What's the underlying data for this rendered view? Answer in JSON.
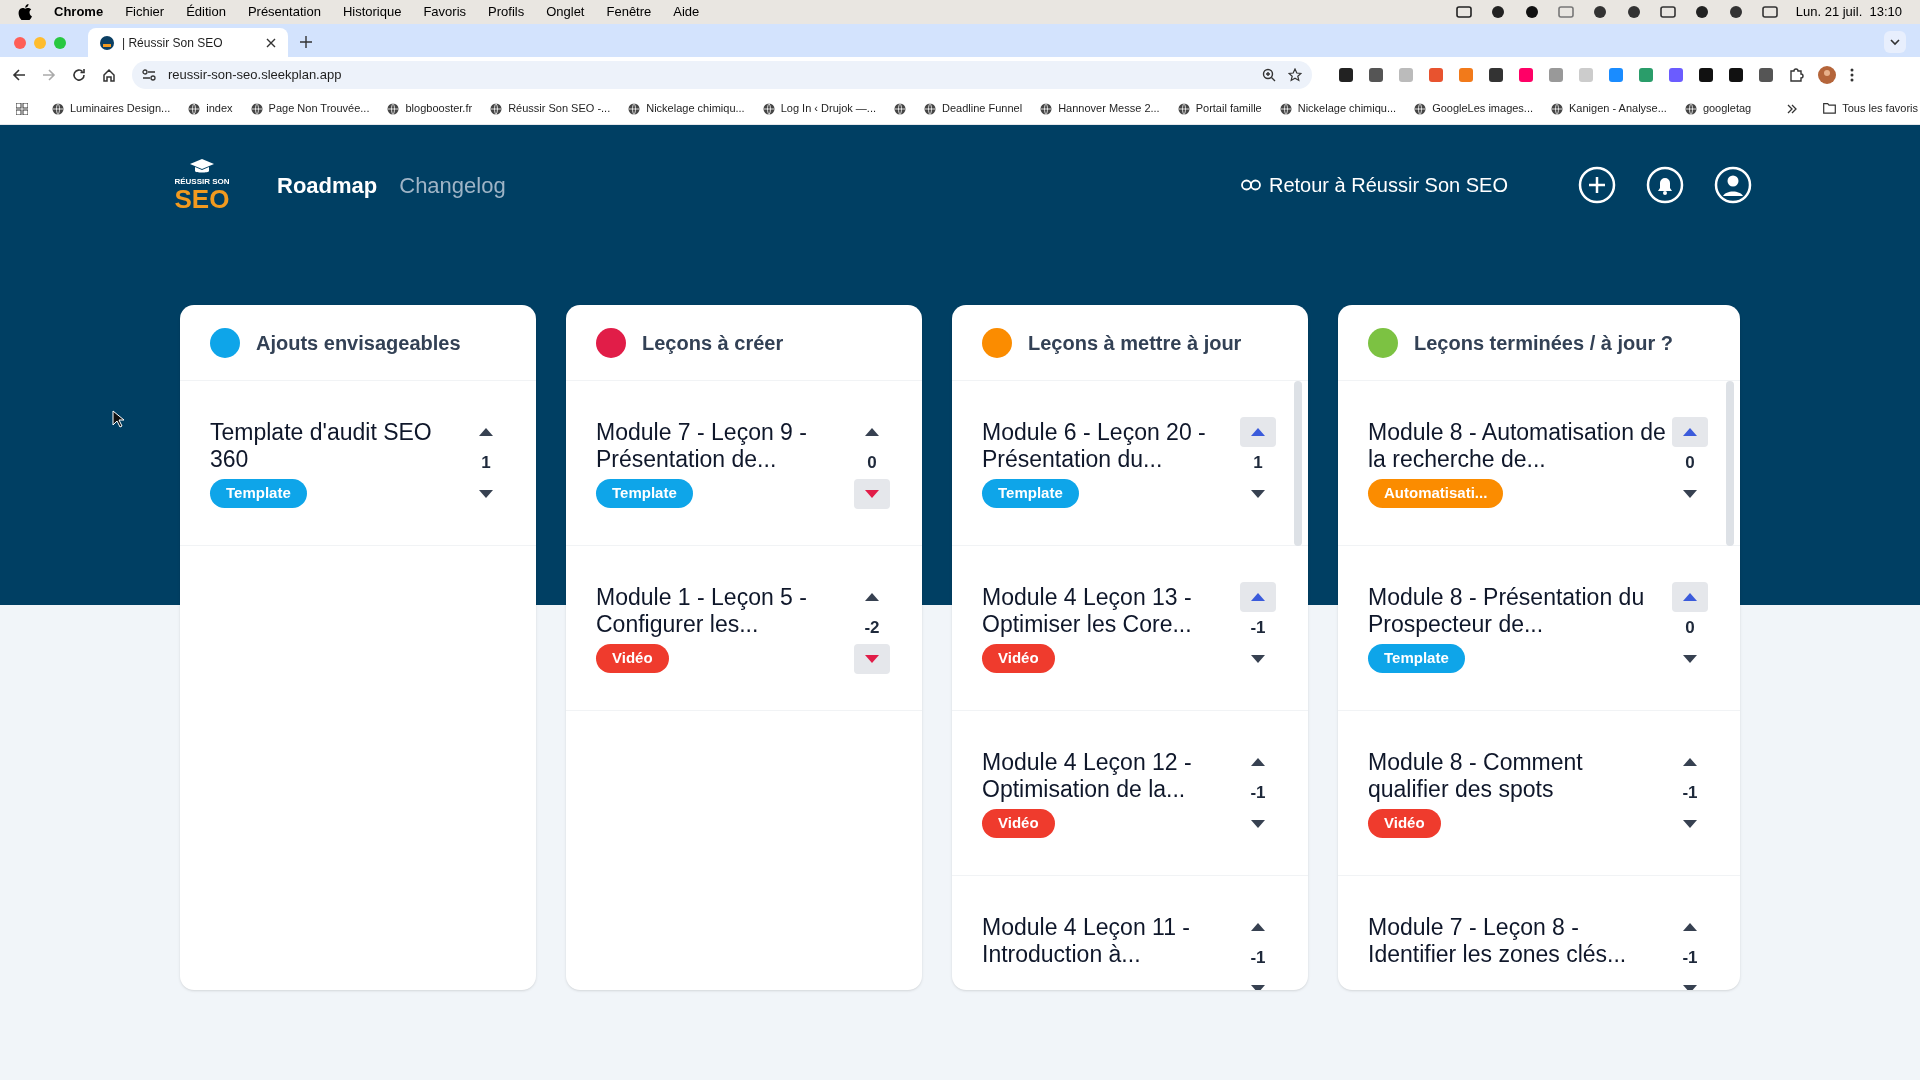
{
  "menu_bar": {
    "app": "Chrome",
    "items": [
      "Fichier",
      "Édition",
      "Présentation",
      "Historique",
      "Favoris",
      "Profils",
      "Onglet",
      "Fenêtre",
      "Aide"
    ],
    "clock": "Lun. 21 juil.  13:10"
  },
  "browser": {
    "tab": {
      "title": "| Réussir Son SEO"
    },
    "url": "reussir-son-seo.sleekplan.app",
    "bookmarks": [
      {
        "kind": "link",
        "label": "Luminaires Design..."
      },
      {
        "kind": "link",
        "label": "index"
      },
      {
        "kind": "link",
        "label": "Page Non Trouvée..."
      },
      {
        "kind": "link",
        "label": "blogbooster.fr"
      },
      {
        "kind": "link",
        "label": "Réussir Son SEO -..."
      },
      {
        "kind": "link",
        "label": "Nickelage chimiqu..."
      },
      {
        "kind": "link",
        "label": "Log In ‹ Drujok —..."
      },
      {
        "kind": "icon"
      },
      {
        "kind": "link",
        "label": "Deadline Funnel"
      },
      {
        "kind": "link",
        "label": "Hannover Messe 2..."
      },
      {
        "kind": "link",
        "label": "Portail famille"
      },
      {
        "kind": "link",
        "label": "Nickelage chimiqu..."
      },
      {
        "kind": "link",
        "label": "GoogleLes images..."
      },
      {
        "kind": "link",
        "label": "Kanigen - Analyse..."
      },
      {
        "kind": "link",
        "label": "googletag"
      }
    ],
    "all_bookmarks": "Tous les favoris"
  },
  "header": {
    "logo": {
      "top": "RÉUSSIR SON",
      "main": "SEO"
    },
    "nav": [
      {
        "label": "Roadmap",
        "selected": true
      },
      {
        "label": "Changelog",
        "selected": false
      }
    ],
    "back_link": "Retour à Réussir Son SEO"
  },
  "columns": [
    {
      "title": "Ajouts envisageables",
      "color": "#0ea5e9",
      "scrollbar": false,
      "cards": [
        {
          "title": "Template d'audit SEO 360",
          "tag": {
            "label": "Template",
            "color": "#0ea5e9"
          },
          "votes": "1",
          "upvoted": false,
          "downvoted": false
        }
      ]
    },
    {
      "title": "Leçons à créer",
      "color": "#e11d48",
      "scrollbar": false,
      "cards": [
        {
          "title": "Module 7 - Leçon 9 - Présentation de...",
          "tag": {
            "label": "Template",
            "color": "#0ea5e9"
          },
          "votes": "0",
          "upvoted": false,
          "downvoted": true
        },
        {
          "title": "Module 1 - Leçon 5 - Configurer les...",
          "tag": {
            "label": "Vidéo",
            "color": "#ef3b2d"
          },
          "votes": "-2",
          "upvoted": false,
          "downvoted": true
        }
      ]
    },
    {
      "title": "Leçons à mettre à jour",
      "color": "#fb8c00",
      "scrollbar": true,
      "cards": [
        {
          "title": "Module 6 - Leçon 20 - Présentation du...",
          "tag": {
            "label": "Template",
            "color": "#0ea5e9"
          },
          "votes": "1",
          "upvoted": true,
          "downvoted": false
        },
        {
          "title": "Module 4 Leçon 13 - Optimiser les Core...",
          "tag": {
            "label": "Vidéo",
            "color": "#ef3b2d"
          },
          "votes": "-1",
          "upvoted": true,
          "downvoted": false
        },
        {
          "title": "Module 4 Leçon 12 - Optimisation de la...",
          "tag": {
            "label": "Vidéo",
            "color": "#ef3b2d"
          },
          "votes": "-1",
          "upvoted": false,
          "downvoted": false
        },
        {
          "title": "Module 4 Leçon 11 - Introduction à...",
          "votes": "-1",
          "upvoted": false,
          "downvoted": false
        }
      ]
    },
    {
      "title": "Leçons terminées / à jour ?",
      "color": "#7cc242",
      "scrollbar": true,
      "cards": [
        {
          "title": "Module 8 - Automatisation de la recherche de...",
          "tag": {
            "label": "Automatisati...",
            "color": "#fb8c00"
          },
          "votes": "0",
          "upvoted": true,
          "downvoted": false
        },
        {
          "title": "Module 8 - Présentation du Prospecteur de...",
          "tag": {
            "label": "Template",
            "color": "#0ea5e9"
          },
          "votes": "0",
          "upvoted": true,
          "downvoted": false
        },
        {
          "title": "Module 8 - Comment qualifier des spots",
          "tag": {
            "label": "Vidéo",
            "color": "#ef3b2d"
          },
          "votes": "-1",
          "upvoted": false,
          "downvoted": false
        },
        {
          "title": "Module 7 - Leçon 8 - Identifier les zones clés...",
          "votes": "-1",
          "upvoted": false,
          "downvoted": false
        }
      ]
    }
  ]
}
